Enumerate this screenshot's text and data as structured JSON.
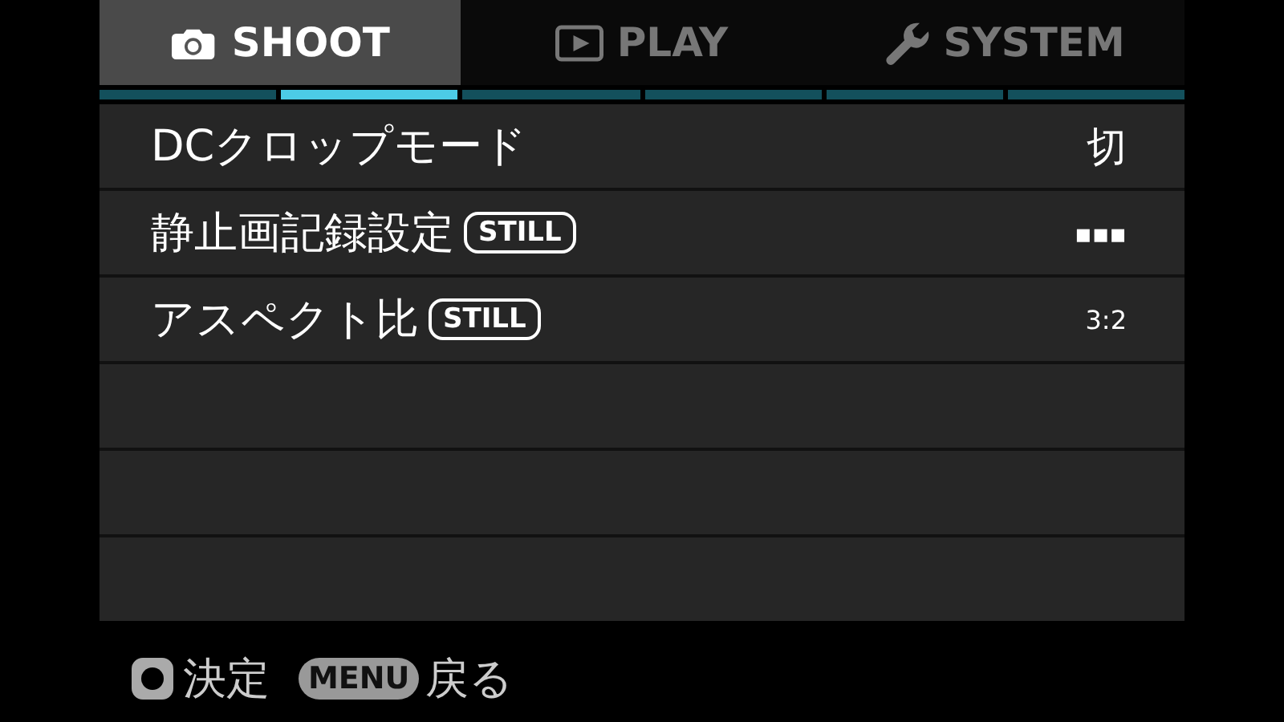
{
  "tabs": [
    {
      "label": "SHOOT",
      "kind": "camera",
      "selected": true
    },
    {
      "label": "PLAY",
      "kind": "play",
      "selected": false
    },
    {
      "label": "SYSTEM",
      "kind": "wrench",
      "selected": false
    }
  ],
  "pages": [
    {
      "selected": false
    },
    {
      "selected": true
    },
    {
      "selected": false
    },
    {
      "selected": false
    },
    {
      "selected": false
    },
    {
      "selected": false
    }
  ],
  "items": [
    {
      "label": "DCクロップモード",
      "value": "切"
    },
    {
      "label": "静止画記録設定",
      "badge": "STILL",
      "value": "▪▪▪"
    },
    {
      "label": "アスペクト比",
      "badge": "STILL",
      "value": "3:2"
    }
  ],
  "footer": [
    {
      "kind": "round",
      "label": "決定"
    },
    {
      "kind": "key",
      "key": "MENU",
      "label": "戻る"
    }
  ]
}
